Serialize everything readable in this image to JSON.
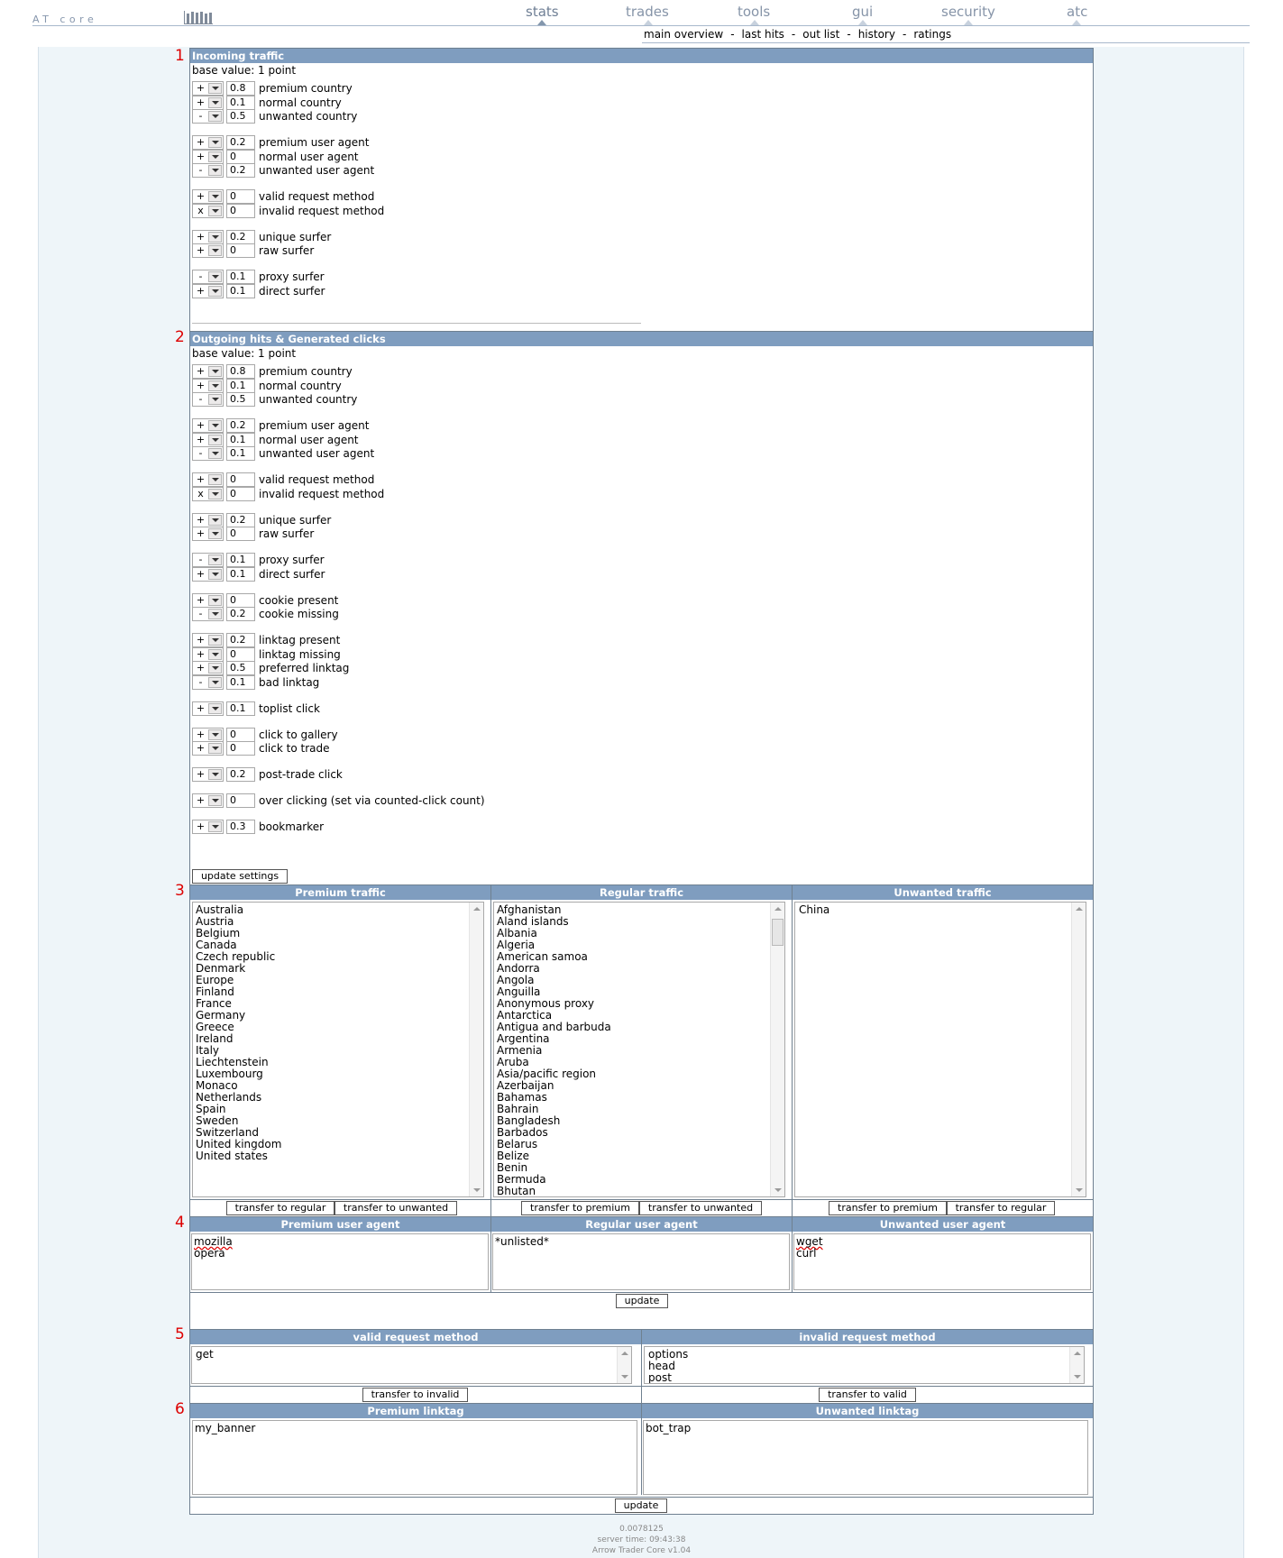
{
  "app": {
    "logo_text": "AT core",
    "version": "Arrow Trader Core v1.04",
    "load_time": "0.0078125",
    "server_time": "server time: 09:43:38"
  },
  "nav": {
    "items": [
      {
        "label": "stats",
        "active": true
      },
      {
        "label": "trades",
        "active": false
      },
      {
        "label": "tools",
        "active": false
      },
      {
        "label": "gui",
        "active": false
      },
      {
        "label": "security",
        "active": false
      },
      {
        "label": "atc",
        "active": false
      }
    ],
    "sub": [
      "main overview",
      "last hits",
      "out list",
      "history",
      "ratings"
    ],
    "sep": "-"
  },
  "sections": {
    "s1": {
      "number": "1",
      "title": "Incoming traffic",
      "base": "base value: 1 point",
      "rows": [
        {
          "op": "+",
          "value": "0.8",
          "label": "premium country"
        },
        {
          "op": "+",
          "value": "0.1",
          "label": "normal country"
        },
        {
          "op": "-",
          "value": "0.5",
          "label": "unwanted country"
        },
        {
          "op": "+",
          "value": "0.2",
          "label": "premium user agent"
        },
        {
          "op": "+",
          "value": "0",
          "label": "normal user agent"
        },
        {
          "op": "-",
          "value": "0.2",
          "label": "unwanted user agent"
        },
        {
          "op": "+",
          "value": "0",
          "label": "valid request method"
        },
        {
          "op": "x",
          "value": "0",
          "label": "invalid request method"
        },
        {
          "op": "+",
          "value": "0.2",
          "label": "unique surfer"
        },
        {
          "op": "+",
          "value": "0",
          "label": "raw surfer"
        },
        {
          "op": "-",
          "value": "0.1",
          "label": "proxy surfer"
        },
        {
          "op": "+",
          "value": "0.1",
          "label": "direct surfer"
        }
      ]
    },
    "s2": {
      "number": "2",
      "title": "Outgoing hits & Generated clicks",
      "base": "base value: 1 point",
      "update_label": "update settings",
      "rows": [
        {
          "op": "+",
          "value": "0.8",
          "label": "premium country"
        },
        {
          "op": "+",
          "value": "0.1",
          "label": "normal country"
        },
        {
          "op": "-",
          "value": "0.5",
          "label": "unwanted country"
        },
        {
          "op": "+",
          "value": "0.2",
          "label": "premium user agent"
        },
        {
          "op": "+",
          "value": "0.1",
          "label": "normal user agent"
        },
        {
          "op": "-",
          "value": "0.1",
          "label": "unwanted user agent"
        },
        {
          "op": "+",
          "value": "0",
          "label": "valid request method"
        },
        {
          "op": "x",
          "value": "0",
          "label": "invalid request method"
        },
        {
          "op": "+",
          "value": "0.2",
          "label": "unique surfer"
        },
        {
          "op": "+",
          "value": "0",
          "label": "raw surfer"
        },
        {
          "op": "-",
          "value": "0.1",
          "label": "proxy surfer"
        },
        {
          "op": "+",
          "value": "0.1",
          "label": "direct surfer"
        },
        {
          "op": "+",
          "value": "0",
          "label": "cookie present"
        },
        {
          "op": "-",
          "value": "0.2",
          "label": "cookie missing"
        },
        {
          "op": "+",
          "value": "0.2",
          "label": "linktag present"
        },
        {
          "op": "+",
          "value": "0",
          "label": "linktag missing"
        },
        {
          "op": "+",
          "value": "0.5",
          "label": "preferred linktag"
        },
        {
          "op": "-",
          "value": "0.1",
          "label": "bad linktag"
        },
        {
          "op": "+",
          "value": "0.1",
          "label": "toplist click"
        },
        {
          "op": "+",
          "value": "0",
          "label": "click to gallery"
        },
        {
          "op": "+",
          "value": "0",
          "label": "click to trade"
        },
        {
          "op": "+",
          "value": "0.2",
          "label": "post-trade click"
        },
        {
          "op": "+",
          "value": "0",
          "label": "over clicking (set via counted-click count)"
        },
        {
          "op": "+",
          "value": "0.3",
          "label": "bookmarker"
        }
      ]
    },
    "s3": {
      "number": "3",
      "premium": {
        "title": "Premium traffic",
        "items": [
          "Australia",
          "Austria",
          "Belgium",
          "Canada",
          "Czech republic",
          "Denmark",
          "Europe",
          "Finland",
          "France",
          "Germany",
          "Greece",
          "Ireland",
          "Italy",
          "Liechtenstein",
          "Luxembourg",
          "Monaco",
          "Netherlands",
          "Spain",
          "Sweden",
          "Switzerland",
          "United kingdom",
          "United states"
        ],
        "btn1": "transfer to regular",
        "btn2": "transfer to unwanted"
      },
      "regular": {
        "title": "Regular traffic",
        "items": [
          "Afghanistan",
          "Aland islands",
          "Albania",
          "Algeria",
          "American samoa",
          "Andorra",
          "Angola",
          "Anguilla",
          "Anonymous proxy",
          "Antarctica",
          "Antigua and barbuda",
          "Argentina",
          "Armenia",
          "Aruba",
          "Asia/pacific region",
          "Azerbaijan",
          "Bahamas",
          "Bahrain",
          "Bangladesh",
          "Barbados",
          "Belarus",
          "Belize",
          "Benin",
          "Bermuda",
          "Bhutan"
        ],
        "btn1": "transfer to premium",
        "btn2": "transfer to unwanted"
      },
      "unwanted": {
        "title": "Unwanted traffic",
        "items": [
          "China"
        ],
        "btn1": "transfer to premium",
        "btn2": "transfer to regular"
      }
    },
    "s4": {
      "number": "4",
      "update_label": "update",
      "premium": {
        "title": "Premium user agent",
        "items": [
          "mozilla",
          "opera"
        ]
      },
      "regular": {
        "title": "Regular user agent",
        "items": [
          "*unlisted*"
        ]
      },
      "unwanted": {
        "title": "Unwanted user agent",
        "items": [
          "wget",
          "curl"
        ]
      }
    },
    "s5": {
      "number": "5",
      "valid": {
        "title": "valid request method",
        "items": [
          "get"
        ],
        "btn": "transfer to invalid"
      },
      "invalid": {
        "title": "invalid request method",
        "items": [
          "options",
          "head",
          "post"
        ],
        "btn": "transfer to valid"
      }
    },
    "s6": {
      "number": "6",
      "update_label": "update",
      "premium": {
        "title": "Premium linktag",
        "items": [
          "my_banner"
        ]
      },
      "unwanted": {
        "title": "Unwanted linktag",
        "items": [
          "bot_trap"
        ]
      }
    }
  },
  "colors": {
    "header_bar": "#7f9dbf",
    "page_bg": "#eef5f9",
    "section_number": "#dd0000",
    "nav_text": "#8694a8"
  }
}
